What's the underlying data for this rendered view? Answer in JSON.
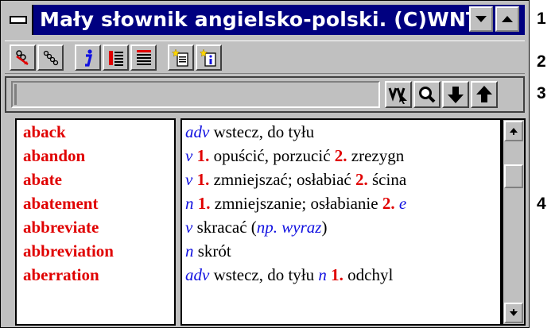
{
  "window": {
    "title": "Mały słownik angielsko-polski. (C)WNT."
  },
  "toolbar": {
    "buttons": [
      "link-remove-icon",
      "link-icon",
      "info-icon",
      "list-red-icon",
      "list-black-icon",
      "new-note-icon",
      "new-info-note-icon"
    ]
  },
  "search": {
    "value": "",
    "buttons": [
      "wildcard-search-icon",
      "magnifier-icon",
      "arrow-down-icon",
      "arrow-up-icon"
    ]
  },
  "word_list": [
    "aback",
    "abandon",
    "abate",
    "abatement",
    "abbreviate",
    "abbreviation",
    "aberration"
  ],
  "definitions": [
    [
      {
        "t": "adv",
        "k": "pos"
      },
      {
        "t": " wstecz, do tyłu",
        "k": "txt"
      }
    ],
    [
      {
        "t": "v",
        "k": "pos"
      },
      {
        "t": " 1.",
        "k": "num"
      },
      {
        "t": " opuścić, porzucić ",
        "k": "txt"
      },
      {
        "t": "2.",
        "k": "num"
      },
      {
        "t": " zrezygn",
        "k": "txt"
      }
    ],
    [
      {
        "t": "v",
        "k": "pos"
      },
      {
        "t": " 1.",
        "k": "num"
      },
      {
        "t": " zmniejszać; osłabiać ",
        "k": "txt"
      },
      {
        "t": "2.",
        "k": "num"
      },
      {
        "t": " ścina",
        "k": "txt"
      }
    ],
    [
      {
        "t": "n",
        "k": "pos"
      },
      {
        "t": " 1.",
        "k": "num"
      },
      {
        "t": " zmniejszanie; osłabianie ",
        "k": "txt"
      },
      {
        "t": "2.",
        "k": "num"
      },
      {
        "t": " e",
        "k": "pos"
      }
    ],
    [
      {
        "t": "v",
        "k": "pos"
      },
      {
        "t": " skracać (",
        "k": "txt"
      },
      {
        "t": "np. wyraz",
        "k": "ex"
      },
      {
        "t": ")",
        "k": "txt"
      }
    ],
    [
      {
        "t": "n",
        "k": "pos"
      },
      {
        "t": " skrót",
        "k": "txt"
      }
    ],
    [
      {
        "t": "adv",
        "k": "pos"
      },
      {
        "t": " wstecz, do tyłu  ",
        "k": "txt"
      },
      {
        "t": "n",
        "k": "pos"
      },
      {
        "t": " 1.",
        "k": "num"
      },
      {
        "t": " odchyl",
        "k": "txt"
      }
    ]
  ],
  "callouts": [
    "1",
    "2",
    "3",
    "4"
  ],
  "colors": {
    "titlebar": "#000080",
    "face": "#c0c0c0",
    "headword": "#e00000",
    "grammar": "#1010e0"
  }
}
